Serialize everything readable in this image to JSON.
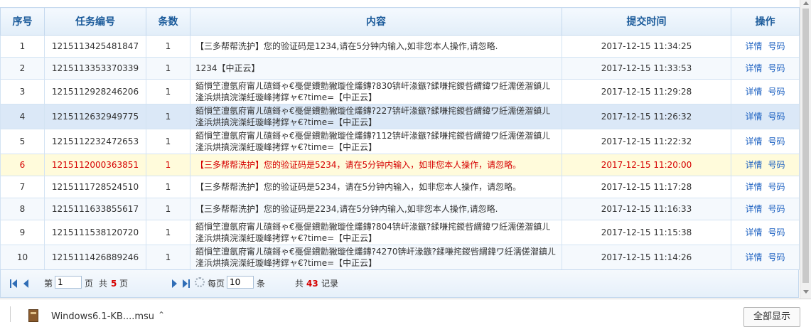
{
  "table": {
    "headers": {
      "seq": "序号",
      "task_id": "任务编号",
      "count": "条数",
      "content": "内容",
      "time": "提交时间",
      "ops": "操作"
    },
    "rows": [
      {
        "seq": "1",
        "task_id": "1215113425481847",
        "count": "1",
        "content": "【三多帮帮洗护】您的验证码是1234,请在5分钟内输入,如非您本人操作,请忽略.",
        "time": "2017-12-15 11:34:25",
        "detail": "详情",
        "number": "号码"
      },
      {
        "seq": "2",
        "task_id": "1215113353370339",
        "count": "1",
        "content": "1234【中正云】",
        "time": "2017-12-15 11:33:53",
        "detail": "详情",
        "number": "号码"
      },
      {
        "seq": "3",
        "task_id": "1215112928246206",
        "count": "1",
        "content": "銆愪笁澶氬府甯ㄦ礂鎶ゃ€戞偍鐨勯獙璇佺爜鏄?830锛屽湪鏃?鍒嗛挓鍐呰緭鍏ワ紝濡傞潪鎮ㄦ湰浜烘搷浣滐紝璇峰拷鐣ャ€?time=【中正云】",
        "time": "2017-12-15 11:29:28",
        "detail": "详情",
        "number": "号码"
      },
      {
        "seq": "4",
        "task_id": "1215112632949775",
        "count": "1",
        "content": "銆愪笁澶氬府甯ㄦ礂鎶ゃ€戞偍鐨勯獙璇佺爜鏄?227锛屽湪鏃?鍒嗛挓鍐呰緭鍏ワ紝濡傞潪鎮ㄦ湰浜烘搷浣滐紝璇峰拷鐣ャ€?time=【中正云】",
        "time": "2017-12-15 11:26:32",
        "detail": "详情",
        "number": "号码"
      },
      {
        "seq": "5",
        "task_id": "1215112232472653",
        "count": "1",
        "content": "銆愪笁澶氬府甯ㄦ礂鎶ゃ€戞偍鐨勯獙璇佺爜鏄?112锛屽湪鏃?鍒嗛挓鍐呰緭鍏ワ紝濡傞潪鎮ㄦ湰浜烘搷浣滐紝璇峰拷鐣ャ€?time=【中正云】",
        "time": "2017-12-15 11:22:32",
        "detail": "详情",
        "number": "号码"
      },
      {
        "seq": "6",
        "task_id": "1215112000363851",
        "count": "1",
        "content": "【三多帮帮洗护】您的验证码是5234，请在5分钟内输入，如非您本人操作，请忽略。",
        "time": "2017-12-15 11:20:00",
        "detail": "详情",
        "number": "号码"
      },
      {
        "seq": "7",
        "task_id": "1215111728524510",
        "count": "1",
        "content": "【三多帮帮洗护】您的验证码是5234，请在5分钟内输入，如非您本人操作，请忽略。",
        "time": "2017-12-15 11:17:28",
        "detail": "详情",
        "number": "号码"
      },
      {
        "seq": "8",
        "task_id": "1215111633855617",
        "count": "1",
        "content": "【三多帮帮洗护】您的验证码是2234,请在5分钟内输入,如非您本人操作,请忽略.",
        "time": "2017-12-15 11:16:33",
        "detail": "详情",
        "number": "号码"
      },
      {
        "seq": "9",
        "task_id": "1215111538120720",
        "count": "1",
        "content": "銆愪笁澶氬府甯ㄦ礂鎶ゃ€戞偍鐨勯獙璇佺爜鏄?804锛屽湪鏃?鍒嗛挓鍐呰緭鍏ワ紝濡傞潪鎮ㄦ湰浜烘搷浣滐紝璇峰拷鐣ャ€?time=【中正云】",
        "time": "2017-12-15 11:15:38",
        "detail": "详情",
        "number": "号码"
      },
      {
        "seq": "10",
        "task_id": "1215111426889246",
        "count": "1",
        "content": "銆愪笁澶氬府甯ㄦ礂鎶ゃ€戞偍鐨勯獙璇佺爜鏄?4270锛屽湪鏃?鍒嗛挓鍐呰緭鍏ワ紝濡傞潪鎮ㄦ湰浜烘搷浣滐紝璇峰拷鐣ャ€?time=【中正云】",
        "time": "2017-12-15 11:14:26",
        "detail": "详情",
        "number": "号码"
      }
    ]
  },
  "pager": {
    "page_prefix": "第",
    "page_value": "1",
    "page_suffix": "页",
    "total_pages_prefix": "共",
    "total_pages": "5",
    "total_pages_suffix": "页",
    "per_page_label": "每页",
    "per_page_value": "10",
    "per_page_unit": "条",
    "total_records_prefix": "共",
    "total_records": "43",
    "total_records_suffix": "记录",
    "icon_color": "#2f6db6"
  },
  "download_bar": {
    "file_name": "Windows6.1-KB....msu",
    "show_all_label": "全部显示"
  },
  "colors": {
    "header_text": "#1a5a9a",
    "highlight_row_bg": "#fffbdb",
    "highlight_row_text": "#d60000",
    "selected_row_bg": "#dbe8f7",
    "link": "#1a5fc0"
  }
}
